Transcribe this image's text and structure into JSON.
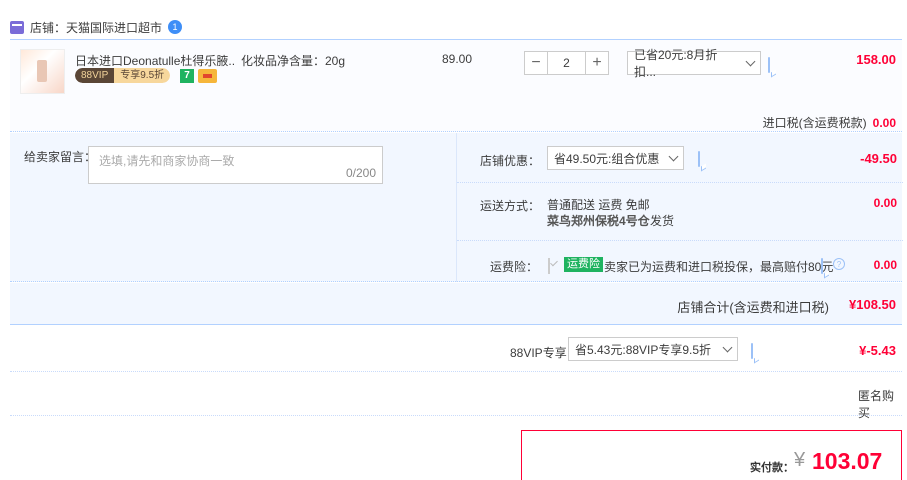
{
  "store": {
    "label": "店铺：",
    "name": "天猫国际进口超市",
    "badge": "1"
  },
  "product": {
    "name": "日本进口Deonatulle杜得乐腋...",
    "spec": "化妆品净含量：20g",
    "unit_price": "89.00",
    "quantity": "2",
    "quantity_minus": "−",
    "quantity_plus": "+",
    "discount_select": "已省20元:8月折扣...",
    "subtotal": "158.00",
    "vip_tag": "88VIP",
    "vip_discount": "专享9.5折",
    "seven_days": "7"
  },
  "tax": {
    "label": "进口税(含运费税款)",
    "value": "0.00"
  },
  "message": {
    "label": "给卖家留言：",
    "placeholder": "选填,请先和商家协商一致",
    "counter": "0/200"
  },
  "store_discount": {
    "label": "店铺优惠：",
    "select": "省49.50元:组合优惠",
    "value": "-49.50"
  },
  "shipping": {
    "label": "运送方式：",
    "line1": "普通配送 运费 免邮",
    "warehouse": "菜鸟郑州保税4号仓",
    "dispatch": "发货",
    "value": "0.00"
  },
  "insurance": {
    "label": "运费险：",
    "tag": "运费险",
    "desc": "卖家已为运费和进口税投保，最高赔付80元",
    "value": "0.00"
  },
  "store_total": {
    "label": "店铺合计(含运费和进口税)",
    "value": "¥108.50"
  },
  "vip": {
    "label": "88VIP专享",
    "select": "省5.43元:88VIP专享9.5折",
    "value": "¥-5.43"
  },
  "anonymous": {
    "label": "匿名购买",
    "checked": true
  },
  "payment": {
    "label": "实付款：",
    "currency": "¥",
    "value": "103.07"
  },
  "colors": {
    "accent": "#ff0036",
    "blue": "#3e8ef7",
    "panel": "#f2f7ff",
    "border": "#b2d1ff"
  }
}
